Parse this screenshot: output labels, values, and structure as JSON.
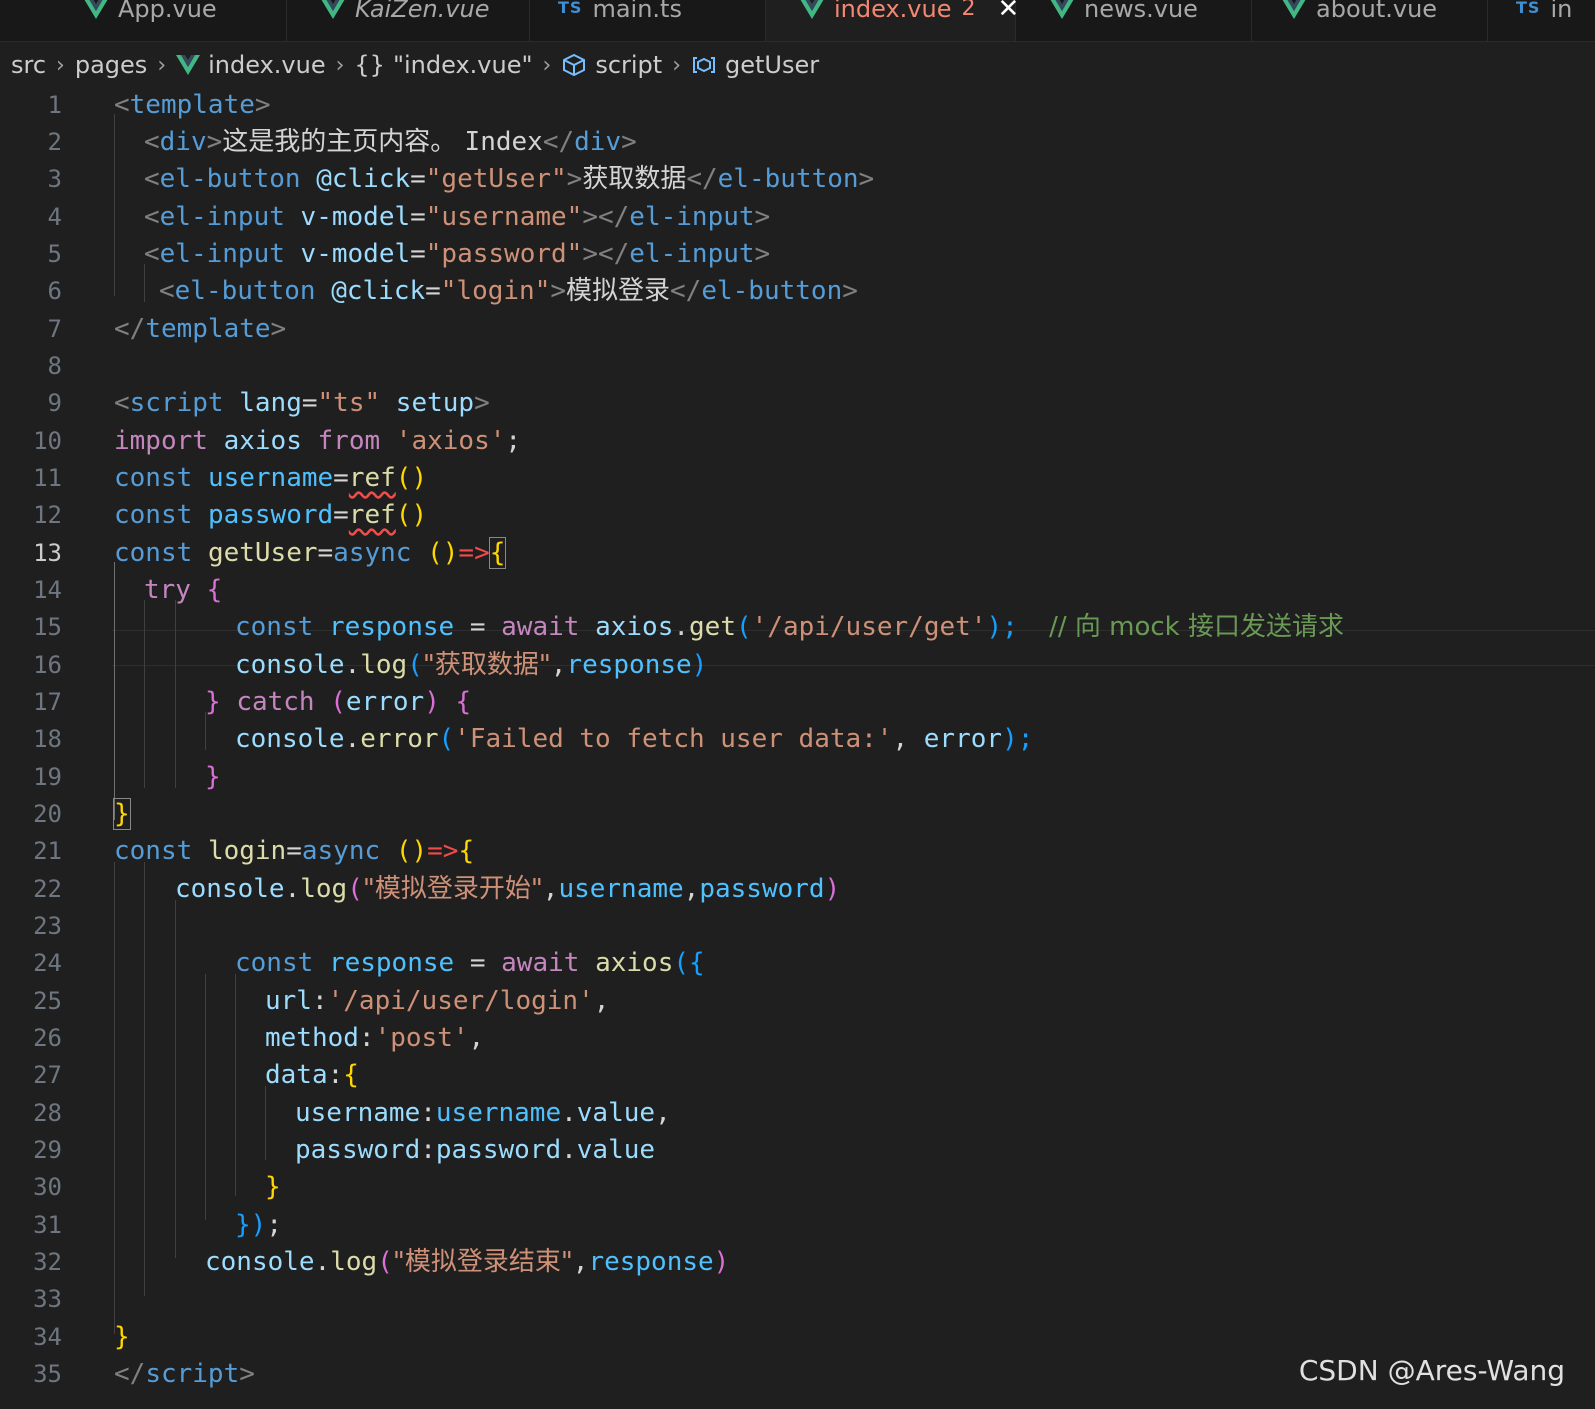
{
  "tabs": [
    {
      "label": "App.vue",
      "icon": "vue-icon"
    },
    {
      "label": "KaiZen.vue",
      "icon": "vue-icon"
    },
    {
      "label": "main.ts",
      "icon": "ts-icon"
    },
    {
      "label": "index.vue",
      "icon": "vue-icon",
      "problems": "2",
      "close": "✕"
    },
    {
      "label": "news.vue",
      "icon": "vue-icon"
    },
    {
      "label": "about.vue",
      "icon": "vue-icon"
    },
    {
      "label": "in",
      "icon": "ts-icon"
    }
  ],
  "ts_icon_text": "TS",
  "breadcrumb": {
    "src": "src",
    "pages": "pages",
    "file": "index.vue",
    "braces": "{}",
    "module": "\"index.vue\"",
    "script": "script",
    "symbol": "getUser",
    "separator": "›"
  },
  "active_line": "13",
  "code": {
    "l1": {
      "ln": "1",
      "t": [
        "<",
        "template",
        ">"
      ]
    },
    "l2": {
      "ln": "2",
      "t": [
        "<",
        "div",
        ">",
        "这是我的主页内容。 ",
        "Index",
        "</",
        "div",
        ">"
      ]
    },
    "l3": {
      "ln": "3",
      "t": [
        "<",
        "el-button",
        " ",
        "@click",
        "=",
        "\"getUser\"",
        ">",
        "获取数据",
        "</",
        "el-button",
        ">"
      ]
    },
    "l4": {
      "ln": "4",
      "t": [
        "<",
        "el-input",
        " ",
        "v-model",
        "=",
        "\"username\"",
        "></",
        "el-input",
        ">"
      ]
    },
    "l5": {
      "ln": "5",
      "t": [
        "<",
        "el-input",
        " ",
        "v-model",
        "=",
        "\"password\"",
        "></",
        "el-input",
        ">"
      ]
    },
    "l6": {
      "ln": "6",
      "t": [
        "<",
        "el-button",
        " ",
        "@click",
        "=",
        "\"login\"",
        ">",
        "模拟登录",
        "</",
        "el-button",
        ">"
      ]
    },
    "l7": {
      "ln": "7",
      "t": [
        "</",
        "template",
        ">"
      ]
    },
    "l8": {
      "ln": "8",
      "t": []
    },
    "l9": {
      "ln": "9",
      "t": [
        "<",
        "script",
        " ",
        "lang",
        "=",
        "\"ts\"",
        " ",
        "setup",
        ">"
      ]
    },
    "l10": {
      "ln": "10",
      "t": [
        "import",
        " ",
        "axios",
        " ",
        "from",
        " ",
        "'axios'",
        ";"
      ]
    },
    "l11": {
      "ln": "11",
      "t": [
        "const",
        " ",
        "username",
        "=",
        "ref",
        "(",
        ")"
      ]
    },
    "l12": {
      "ln": "12",
      "t": [
        "const",
        " ",
        "password",
        "=",
        "ref",
        "(",
        ")"
      ]
    },
    "l13": {
      "ln": "13",
      "t": [
        "const",
        " ",
        "getUser",
        "=",
        "async",
        " ",
        "()",
        "=>",
        "{"
      ]
    },
    "l14": {
      "ln": "14",
      "t": [
        "try",
        " ",
        "{"
      ]
    },
    "l15": {
      "ln": "15",
      "t": [
        "const",
        " ",
        "response",
        " = ",
        "await",
        " ",
        "axios",
        ".",
        "get",
        "(",
        "'/api/user/get'",
        ");",
        "  ",
        "// 向 mock 接口发送请求"
      ]
    },
    "l16": {
      "ln": "16",
      "t": [
        "console",
        ".",
        "log",
        "(",
        "\"获取数据\"",
        ",",
        "response",
        ")"
      ]
    },
    "l17": {
      "ln": "17",
      "t": [
        "}",
        " ",
        "catch",
        " ",
        "(",
        "error",
        ")",
        " ",
        "{"
      ]
    },
    "l18": {
      "ln": "18",
      "t": [
        "console",
        ".",
        "error",
        "(",
        "'Failed to fetch user data:'",
        ", ",
        "error",
        ");"
      ]
    },
    "l19": {
      "ln": "19",
      "t": [
        "}"
      ]
    },
    "l20": {
      "ln": "20",
      "t": [
        "}"
      ]
    },
    "l21": {
      "ln": "21",
      "t": [
        "const",
        " ",
        "login",
        "=",
        "async",
        " ",
        "()",
        "=>",
        "{"
      ]
    },
    "l22": {
      "ln": "22",
      "t": [
        "console",
        ".",
        "log",
        "(",
        "\"模拟登录开始\"",
        ",",
        "username",
        ",",
        "password",
        ")"
      ]
    },
    "l23": {
      "ln": "23",
      "t": []
    },
    "l24": {
      "ln": "24",
      "t": [
        "const",
        " ",
        "response",
        " = ",
        "await",
        " ",
        "axios",
        "(",
        "{"
      ]
    },
    "l25": {
      "ln": "25",
      "t": [
        "url",
        ":",
        "'/api/user/login'",
        ","
      ]
    },
    "l26": {
      "ln": "26",
      "t": [
        "method",
        ":",
        "'post'",
        ","
      ]
    },
    "l27": {
      "ln": "27",
      "t": [
        "data",
        ":",
        "{"
      ]
    },
    "l28": {
      "ln": "28",
      "t": [
        "username",
        ":",
        "username",
        ".",
        "value",
        ","
      ]
    },
    "l29": {
      "ln": "29",
      "t": [
        "password",
        ":",
        "password",
        ".",
        "value"
      ]
    },
    "l30": {
      "ln": "30",
      "t": [
        "}"
      ]
    },
    "l31": {
      "ln": "31",
      "t": [
        "}",
        ")",
        ";"
      ]
    },
    "l32": {
      "ln": "32",
      "t": [
        "console",
        ".",
        "log",
        "(",
        "\"模拟登录结束\"",
        ",",
        "response",
        ")"
      ]
    },
    "l33": {
      "ln": "33",
      "t": []
    },
    "l34": {
      "ln": "34",
      "t": [
        "}"
      ]
    },
    "l35": {
      "ln": "35",
      "t": [
        "</",
        "script",
        ">"
      ]
    }
  },
  "watermark": "CSDN @Ares-Wang",
  "colors": {
    "background": "#1f1f1f",
    "active_tab_text": "#f48771",
    "keyword": "#569cd6",
    "string": "#ce9178",
    "function": "#dcdcaa",
    "comment": "#6a9955",
    "variable": "#4fc1ff",
    "vue_green": "#41b883"
  }
}
